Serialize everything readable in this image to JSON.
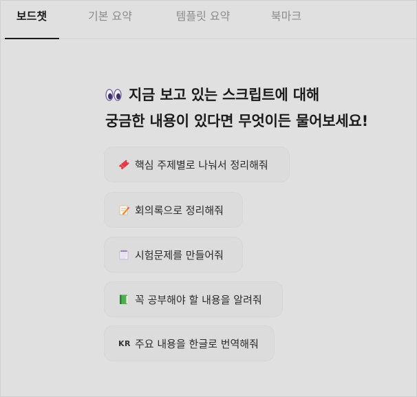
{
  "tabs": [
    {
      "label": "보드챗",
      "active": true
    },
    {
      "label": "기본 요약",
      "active": false
    },
    {
      "label": "템플릿 요약",
      "active": false
    },
    {
      "label": "북마크",
      "active": false
    }
  ],
  "prompt": {
    "line1": "지금 보고 있는 스크립트에 대해",
    "line2": "궁금한 내용이 있다면 무엇이든 물어보세요!",
    "icon": "eyes-icon"
  },
  "suggestions": [
    {
      "label": "핵심 주제별로 나눠서 정리해줘",
      "icon": "ticket-icon"
    },
    {
      "label": "회의록으로 정리해줘",
      "icon": "memo-icon"
    },
    {
      "label": "시험문제를 만들어줘",
      "icon": "spiral-notepad-icon"
    },
    {
      "label": "꼭 공부해야 할 내용을 알려줘",
      "icon": "green-book-icon"
    },
    {
      "label": "주요 내용을 한글로 번역해줘",
      "icon": "kr-letters-icon",
      "prefix": "KR"
    }
  ],
  "colors": {
    "background": "#e0e0e0",
    "active_tab": "#1a1a1a",
    "inactive_tab": "#8b8b8b"
  }
}
